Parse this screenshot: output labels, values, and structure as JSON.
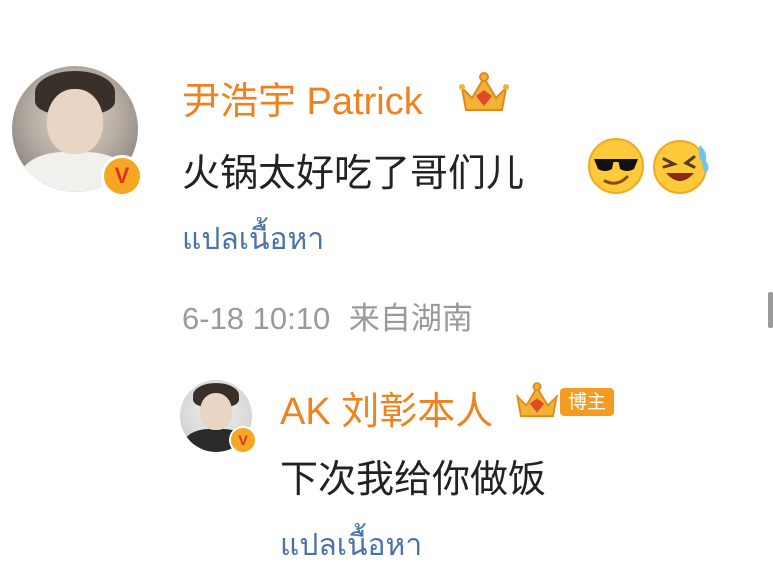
{
  "comment": {
    "author": "尹浩宇 Patrick",
    "author_badge": "crown-vip-icon",
    "verified_badge": "V",
    "text": "火锅太好吃了哥们儿",
    "emojis": [
      "sunglasses-smirk-emoji",
      "laugh-cry-emoji"
    ],
    "translate_label": "แปลเนื้อหา",
    "timestamp": "6-18 10:10",
    "location": "来自湖南"
  },
  "reply": {
    "author": "AK 刘彰本人",
    "author_badge": "crown-vip-icon",
    "role_tag": "博主",
    "verified_badge": "V",
    "text": "下次我给你做饭"
  },
  "colors": {
    "username": "#f0811f",
    "link": "#4a73a8",
    "meta": "#9a9a9a",
    "text": "#222222",
    "badge": "#f5a623"
  }
}
